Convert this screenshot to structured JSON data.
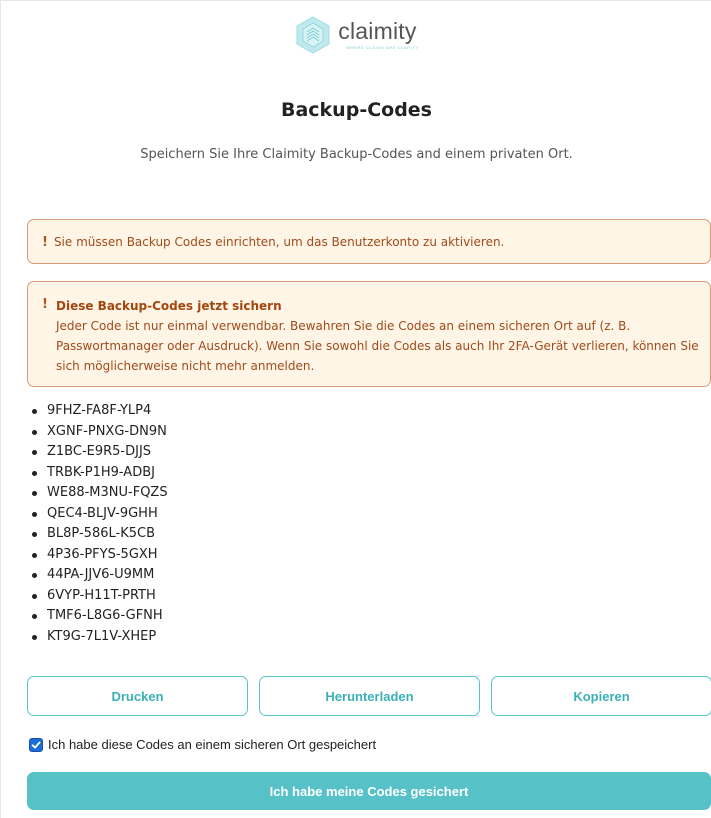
{
  "brand": {
    "name": "claimity",
    "tagline": "WHERE CLAIMS ARE CLARITY",
    "accent": "#56c2c8",
    "logo_icon": "hexagon-logo-icon"
  },
  "page": {
    "title": "Backup-Codes",
    "subtitle": "Speichern Sie Ihre Claimity Backup-Codes and einem privaten Ort."
  },
  "alerts": {
    "setup_required": {
      "icon": "!",
      "text": "Sie müssen Backup Codes einrichten, um das Benutzerkonto zu aktivieren."
    },
    "save_now": {
      "icon": "!",
      "heading": "Diese Backup-Codes jetzt sichern",
      "text": "Jeder Code ist nur einmal verwendbar. Bewahren Sie die Codes an einem sicheren Ort auf (z. B. Passwortmanager oder Ausdruck). Wenn Sie sowohl die Codes als auch Ihr 2FA-Gerät verlieren, können Sie sich möglicherweise nicht mehr anmelden."
    }
  },
  "codes": [
    "9FHZ-FA8F-YLP4",
    "XGNF-PNXG-DN9N",
    "Z1BC-E9R5-DJJS",
    "TRBK-P1H9-ADBJ",
    "WE88-M3NU-FQZS",
    "QEC4-BLJV-9GHH",
    "BL8P-586L-K5CB",
    "4P36-PFYS-5GXH",
    "44PA-JJV6-U9MM",
    "6VYP-H11T-PRTH",
    "TMF6-L8G6-GFNH",
    "KT9G-7L1V-XHEP"
  ],
  "actions": {
    "print_label": "Drucken",
    "download_label": "Herunterladen",
    "copy_label": "Kopieren"
  },
  "confirm": {
    "checked": true,
    "label": "Ich habe diese Codes an einem sicheren Ort gespeichert"
  },
  "submit": {
    "label": "Ich habe meine Codes gesichert"
  }
}
